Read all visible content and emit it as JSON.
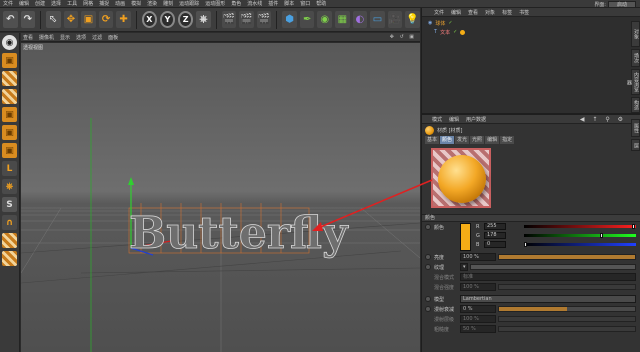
{
  "menubar": {
    "items": [
      "文件",
      "编辑",
      "创建",
      "选择",
      "工具",
      "网格",
      "捕捉",
      "动画",
      "模拟",
      "渲染",
      "雕刻",
      "运动跟踪",
      "运动图形",
      "角色",
      "流水线",
      "插件",
      "脚本",
      "窗口",
      "帮助"
    ],
    "layout_label": "界面:",
    "layout_value": "启动"
  },
  "toolbar": {
    "axis_x": "X",
    "axis_y": "Y",
    "axis_z": "Z"
  },
  "viewport": {
    "menu": [
      "查看",
      "摄像机",
      "显示",
      "选项",
      "过滤",
      "面板"
    ],
    "label": "透视视图",
    "scene_text": "Butterfly"
  },
  "object_manager": {
    "menu": [
      "文件",
      "编辑",
      "查看",
      "对象",
      "标签",
      "书签"
    ],
    "rows": [
      {
        "name": "球体"
      },
      {
        "name": "文本"
      }
    ],
    "side_tabs": [
      "对象",
      "场次",
      "内容浏览器",
      "构造"
    ]
  },
  "attribute_manager": {
    "menu": [
      "模式",
      "编辑",
      "用户数据"
    ],
    "title": "材质 [材质]",
    "tabs": [
      "基本",
      "颜色",
      "发光",
      "光照",
      "编辑",
      "指定"
    ],
    "active_tab": "颜色",
    "side_tabs": [
      "属性",
      "层"
    ],
    "section_label": "颜色",
    "color_label": "颜色",
    "channels": [
      {
        "label": "R",
        "value": "255",
        "knob": 1.0
      },
      {
        "label": "G",
        "value": "178",
        "knob": 0.7
      },
      {
        "label": "B",
        "value": "0",
        "knob": 0.0
      }
    ],
    "brightness_label": "亮度",
    "brightness_value": "100 %",
    "brightness": 1.0,
    "texture_label": "纹理",
    "blend_mode_label": "混合模式",
    "blend_mode_value": "标准",
    "blend_strength_label": "混合强度",
    "blend_strength_value": "100 %",
    "model_label": "模型",
    "model_value": "Lambertian",
    "diffuse_falloff_label": "漫射衰减",
    "diffuse_falloff_value": "0 %",
    "diffuse_falloff": 0.5,
    "diffuse_level_label": "漫射层级",
    "diffuse_level_value": "100 %",
    "roughness_label": "粗糙度",
    "roughness_value": "50 %"
  },
  "colors": {
    "material": "#f5ad16",
    "annotation_arrow": "#e02020",
    "active_tab": "#6a84a8"
  }
}
